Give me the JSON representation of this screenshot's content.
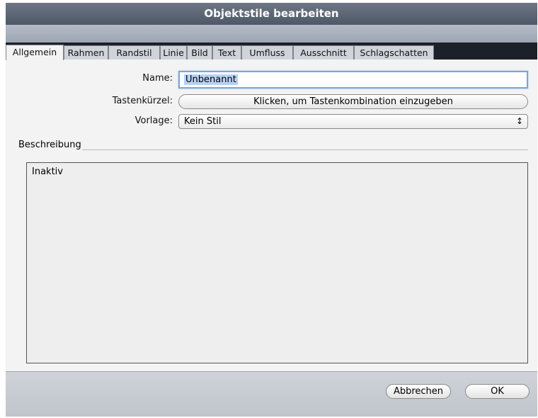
{
  "window": {
    "title": "Objektstile bearbeiten"
  },
  "tabs": [
    {
      "label": "Allgemein",
      "active": true
    },
    {
      "label": "Rahmen"
    },
    {
      "label": "Randstil"
    },
    {
      "label": "Linie"
    },
    {
      "label": "Bild"
    },
    {
      "label": "Text"
    },
    {
      "label": "Umfluss"
    },
    {
      "label": "Ausschnitt"
    },
    {
      "label": "Schlagschatten"
    }
  ],
  "form": {
    "name_label": "Name:",
    "name_value": "Unbenannt",
    "shortcut_label": "Tastenkürzel:",
    "shortcut_button": "Klicken, um Tastenkombination einzugeben",
    "template_label": "Vorlage:",
    "template_value": "Kein Stil",
    "select_arrow_icon": "updown-arrows-icon"
  },
  "description": {
    "label": "Beschreibung",
    "text": "Inaktiv"
  },
  "buttons": {
    "cancel": "Abbrechen",
    "ok": "OK"
  }
}
